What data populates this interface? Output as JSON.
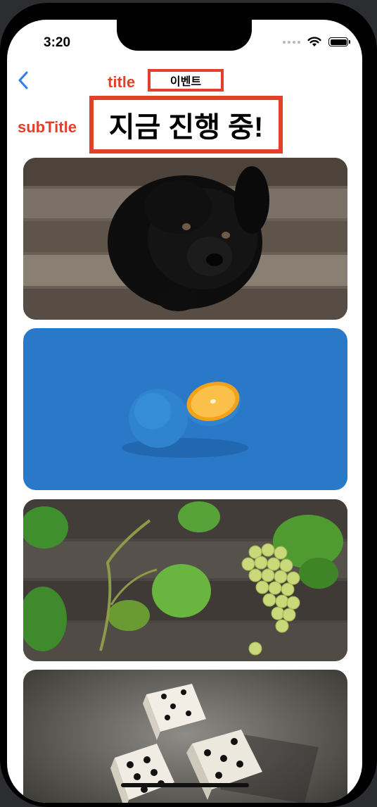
{
  "status_bar": {
    "time": "3:20"
  },
  "annotations": {
    "title_label": "title",
    "subtitle_label": "subTitle"
  },
  "nav": {
    "back_icon": "chevron-left-icon",
    "title": "이벤트"
  },
  "header": {
    "subtitle": "지금 진행 중!"
  },
  "colors": {
    "annotation": "#e2402b",
    "accent": "#2f7cf6"
  },
  "events": [
    {
      "image": "black puppy on wooden floor"
    },
    {
      "image": "blue orange half-peeled on blue background"
    },
    {
      "image": "green grapes and vine leaves on wood"
    },
    {
      "image": "white dice on gray background"
    }
  ]
}
